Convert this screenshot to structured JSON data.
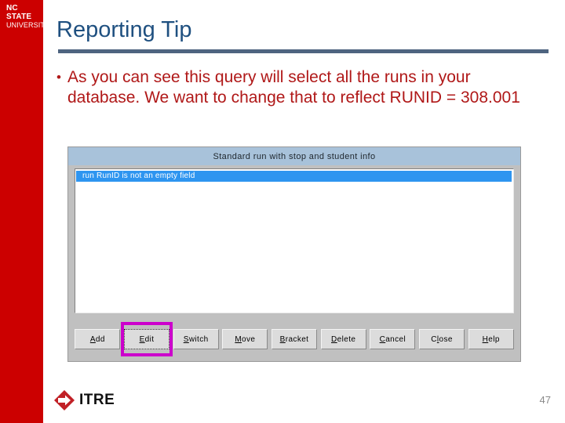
{
  "brand": {
    "logo_line1": "NC STATE",
    "logo_line2": "UNIVERSITY",
    "bar_color": "#cc0000"
  },
  "slide": {
    "title": "Reporting Tip",
    "title_color": "#1f5080",
    "rule_color": "#4e6480",
    "bullet_color": "#b01818",
    "bullet_marker": "•",
    "bullet_text": "As you can see this query will select all the runs in your database.  We want to change that to reflect RUNID = 308.001"
  },
  "dialog": {
    "title": "Standard run with stop and student info",
    "titlebar_color": "#a8c2da",
    "face_color": "#c0c0c0",
    "selection_color": "#2e95f0",
    "highlight_color": "#cc00cc",
    "list_rows": [
      {
        "text": "run RunID  is not an empty field",
        "selected": true
      }
    ],
    "buttons": [
      {
        "label": "Add",
        "accel": "A",
        "before": "",
        "after": "dd",
        "highlighted": false
      },
      {
        "label": "Edit",
        "accel": "E",
        "before": "",
        "after": "dit",
        "highlighted": true
      },
      {
        "label": "Switch",
        "accel": "S",
        "before": "",
        "after": "witch",
        "highlighted": false
      },
      {
        "label": "Move",
        "accel": "M",
        "before": "",
        "after": "ove",
        "highlighted": false
      },
      {
        "label": "Bracket",
        "accel": "B",
        "before": "",
        "after": "racket",
        "highlighted": false
      },
      {
        "label": "Delete",
        "accel": "D",
        "before": "",
        "after": "elete",
        "highlighted": false
      },
      {
        "label": "Cancel",
        "accel": "C",
        "before": "",
        "after": "ancel",
        "highlighted": false
      },
      {
        "label": "Close",
        "accel": "l",
        "before": "C",
        "after": "ose",
        "highlighted": false
      },
      {
        "label": "Help",
        "accel": "H",
        "before": "",
        "after": "elp",
        "highlighted": false
      }
    ]
  },
  "footer": {
    "logo_text": "ITRE",
    "logo_mark_color": "#c12026",
    "page_number": "47"
  }
}
